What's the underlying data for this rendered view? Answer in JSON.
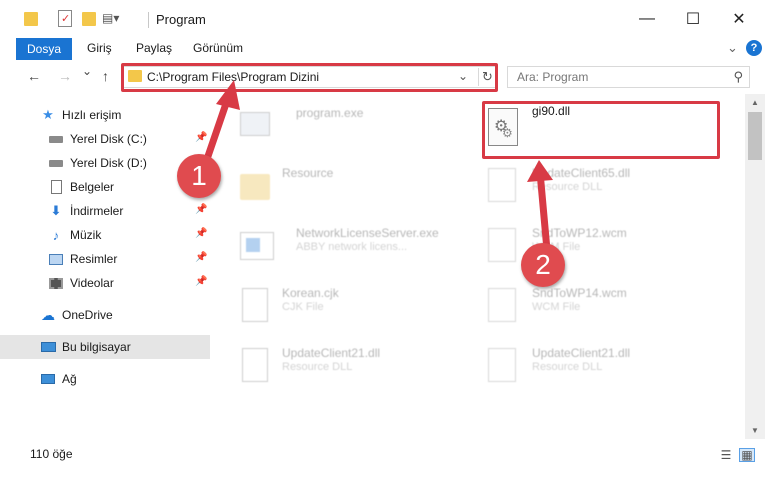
{
  "window": {
    "title": "Program",
    "minimize_glyph": "—",
    "maximize_glyph": "☐",
    "close_glyph": "✕"
  },
  "ribbon": {
    "file_tab": "Dosya",
    "tabs": [
      "Giriş",
      "Paylaş",
      "Görünüm"
    ],
    "help_glyph": "?"
  },
  "navigation": {
    "back_glyph": "←",
    "forward_glyph": "→",
    "recent_glyph": "⌄",
    "up_glyph": "↑",
    "address_path": "C:\\Program Files\\Program Dizini",
    "chevron_glyph": "⌄",
    "refresh_glyph": "↻",
    "search_placeholder": "Ara: Program",
    "search_glyph": "⚲"
  },
  "sidebar": {
    "items": [
      {
        "label": "Hızlı erişim",
        "icon": "star-icon",
        "pinned": false
      },
      {
        "label": "Yerel Disk (C:)",
        "icon": "drive-icon",
        "pinned": true
      },
      {
        "label": "Yerel Disk (D:)",
        "icon": "drive-icon",
        "pinned": false
      },
      {
        "label": "Belgeler",
        "icon": "document-icon",
        "pinned": false
      },
      {
        "label": "İndirmeler",
        "icon": "download-icon",
        "pinned": true
      },
      {
        "label": "Müzik",
        "icon": "music-icon",
        "pinned": true
      },
      {
        "label": "Resimler",
        "icon": "pictures-icon",
        "pinned": true
      },
      {
        "label": "Videolar",
        "icon": "video-icon",
        "pinned": true
      },
      {
        "label": "OneDrive",
        "icon": "cloud-icon",
        "pinned": false
      },
      {
        "label": "Bu bilgisayar",
        "icon": "computer-icon",
        "pinned": false,
        "selected": true
      },
      {
        "label": "Ağ",
        "icon": "network-icon",
        "pinned": false
      }
    ],
    "pin_glyph": "📌"
  },
  "files": {
    "left": [
      {
        "name": "program.exe",
        "sub": ""
      },
      {
        "name": "Resource",
        "sub": ""
      },
      {
        "name": "NetworkLicenseServer.exe",
        "sub": "ABBY network licens..."
      },
      {
        "name": "Korean.cjk",
        "sub": "CJK File"
      },
      {
        "name": "UpdateClient21.dll",
        "sub": "Resource DLL"
      }
    ],
    "right": [
      {
        "name": "gi90.dll",
        "sub": ""
      },
      {
        "name": "UpdateClient65.dll",
        "sub": "Resource DLL"
      },
      {
        "name": "SndToWP12.wcm",
        "sub": "WCM File"
      },
      {
        "name": "SndToWP14.wcm",
        "sub": "WCM File"
      },
      {
        "name": "UpdateClient21.dll",
        "sub": "Resource DLL"
      }
    ]
  },
  "status": {
    "item_count": "110 öğe"
  },
  "annotations": {
    "marker_1": "1",
    "marker_2": "2",
    "color": "#d83a45"
  },
  "colors": {
    "accent": "#1a74d2",
    "folder": "#f3c74a",
    "selection": "#e5e5e5"
  }
}
